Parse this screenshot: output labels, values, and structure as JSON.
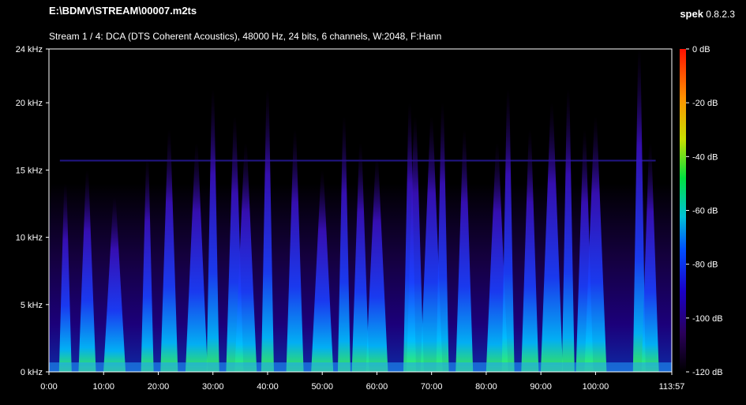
{
  "header": {
    "file_path": "E:\\BDMV\\STREAM\\00007.m2ts",
    "stream_info": "Stream 1 / 4: DCA (DTS Coherent Acoustics), 48000 Hz, 24 bits, 6 channels, W:2048, F:Hann"
  },
  "brand": {
    "name": "spek",
    "version": "0.8.2.3"
  },
  "chart_data": {
    "type": "heatmap",
    "title": "",
    "x_axis": {
      "ticks": [
        "0:00",
        "10:00",
        "20:00",
        "30:00",
        "40:00",
        "50:00",
        "60:00",
        "70:00",
        "80:00",
        "90:00",
        "100:00",
        "113:57"
      ],
      "range_seconds": [
        0,
        6837
      ]
    },
    "y_axis": {
      "ticks": [
        "0 kHz",
        "5 kHz",
        "10 kHz",
        "15 kHz",
        "20 kHz",
        "24 kHz"
      ],
      "range_khz": [
        0,
        24
      ]
    },
    "colorbar": {
      "ticks": [
        "0 dB",
        "-20 dB",
        "-40 dB",
        "-60 dB",
        "-80 dB",
        "-100 dB",
        "-120 dB"
      ],
      "range_db": [
        -120,
        0
      ]
    },
    "colors": {
      "background": "#000000",
      "axis": "#ffffff"
    },
    "energy_profile_note_free": true,
    "spikes_minutes": [
      3,
      7,
      12,
      18,
      22,
      27,
      30,
      34,
      36,
      40,
      45,
      50,
      54,
      57,
      60,
      66,
      67,
      70,
      72,
      76,
      82,
      84,
      88,
      92,
      95,
      98,
      100,
      108,
      110
    ],
    "spike_top_khz": [
      14,
      15,
      13,
      16,
      18,
      17,
      21,
      19,
      17,
      21,
      18,
      15,
      19,
      17,
      16,
      20,
      19,
      19,
      20,
      18,
      17,
      21,
      18,
      20,
      21,
      18,
      19,
      24,
      17
    ],
    "line_freq_khz": 15.7
  }
}
